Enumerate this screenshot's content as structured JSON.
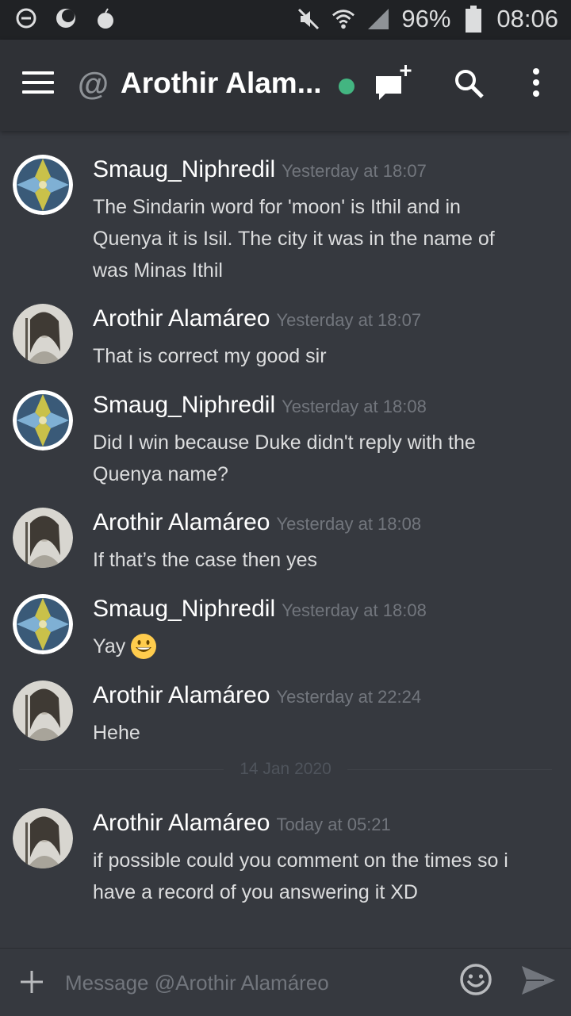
{
  "status_bar": {
    "battery_percent": "96%",
    "time": "08:06",
    "icons": [
      "dnd-icon",
      "moon-icon",
      "apple-icon",
      "mute-icon",
      "wifi-icon",
      "signal-icon",
      "battery-icon"
    ]
  },
  "header": {
    "channel_prefix_icon": "at-icon",
    "title": "Arothir Alam...",
    "status": "online",
    "status_color": "#43b581"
  },
  "messages": [
    {
      "author": "Smaug_Niphredil",
      "timestamp": "Yesterday at 18:07",
      "avatar": "mosaic",
      "lines": [
        "The Sindarin word for 'moon' is Ithil and in",
        "Quenya it is Isil. The city it was in the name of",
        "was Minas Ithil"
      ]
    },
    {
      "author": "Arothir Alamáreo",
      "timestamp": "Yesterday at 18:07",
      "avatar": "portrait",
      "lines": [
        "That is correct my good sir"
      ]
    },
    {
      "author": "Smaug_Niphredil",
      "timestamp": "Yesterday at 18:08",
      "avatar": "mosaic",
      "lines": [
        "Did I win because Duke didn't reply with the",
        "Quenya name?"
      ]
    },
    {
      "author": "Arothir Alamáreo",
      "timestamp": "Yesterday at 18:08",
      "avatar": "portrait",
      "lines": [
        "If that’s the case then yes"
      ]
    },
    {
      "author": "Smaug_Niphredil",
      "timestamp": "Yesterday at 18:08",
      "avatar": "mosaic",
      "lines": [
        "Yay"
      ],
      "emoji": "grinning-face-emoji"
    },
    {
      "author": "Arothir Alamáreo",
      "timestamp": "Yesterday at 22:24",
      "avatar": "portrait",
      "lines": [
        "Hehe"
      ]
    },
    {
      "author": "Arothir Alamáreo",
      "timestamp": "Today at 05:21",
      "avatar": "portrait",
      "lines": [
        "if possible could you comment on the times so i",
        "have a record of you answering it XD"
      ]
    }
  ],
  "date_divider": "14 Jan 2020",
  "composer": {
    "placeholder": "Message @Arothir Alamáreo",
    "icons": [
      "plus-icon",
      "emoji-icon",
      "send-icon"
    ]
  },
  "colors": {
    "background": "#36393f",
    "header": "#2f3136",
    "status_bar": "#202225",
    "timestamp": "#72767d"
  }
}
